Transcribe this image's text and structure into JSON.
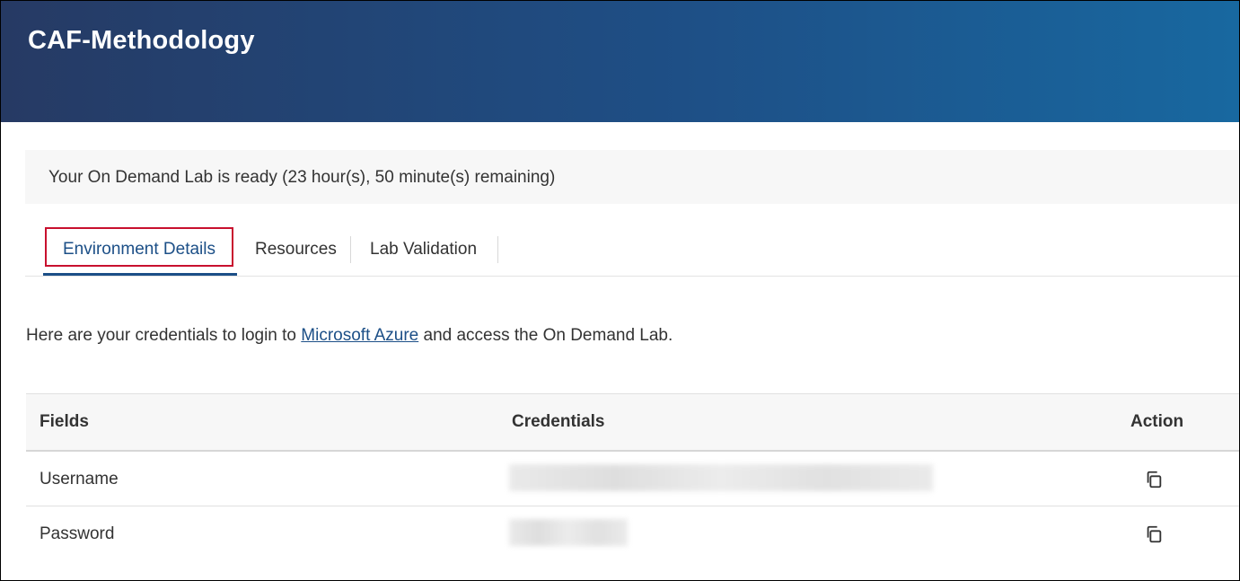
{
  "header": {
    "title": "CAF-Methodology"
  },
  "status": {
    "message": "Your On Demand Lab is ready (23 hour(s), 50 minute(s) remaining)"
  },
  "tabs": [
    {
      "label": "Environment Details",
      "active": true
    },
    {
      "label": "Resources",
      "active": false
    },
    {
      "label": "Lab Validation",
      "active": false
    }
  ],
  "intro": {
    "before": "Here are your credentials to login to ",
    "link": "Microsoft Azure",
    "after": " and access the On Demand Lab."
  },
  "table": {
    "headers": {
      "fields": "Fields",
      "credentials": "Credentials",
      "action": "Action"
    },
    "rows": [
      {
        "field": "Username",
        "credential": "",
        "action_icon": "copy-icon"
      },
      {
        "field": "Password",
        "credential": "",
        "action_icon": "copy-icon"
      }
    ]
  },
  "colors": {
    "header_start": "#263a64",
    "header_end": "#1868a0",
    "accent": "#1c4f87",
    "highlight": "#c8102e"
  }
}
